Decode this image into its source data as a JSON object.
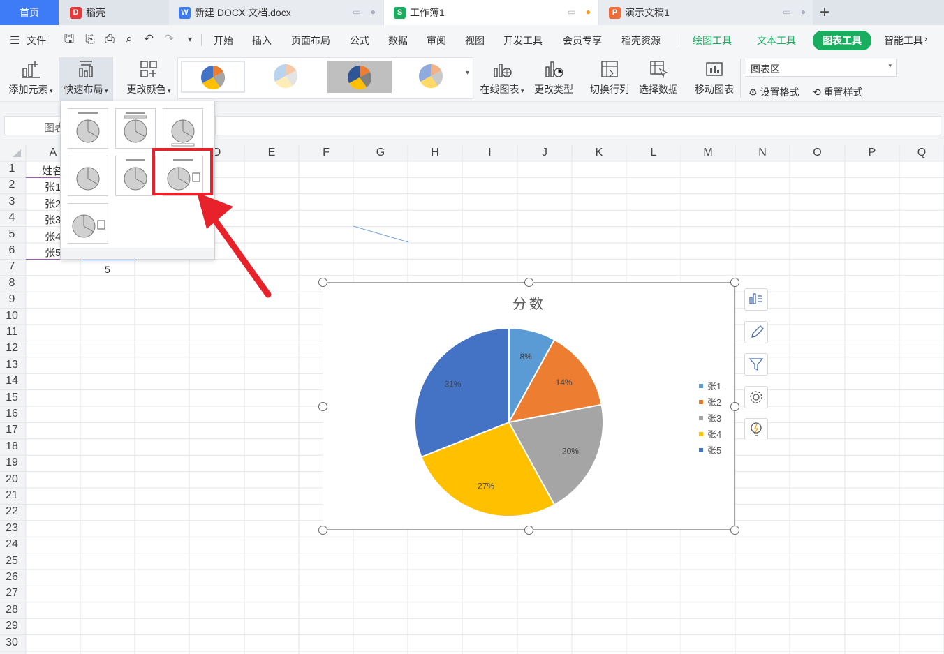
{
  "tabs": [
    {
      "label": "首页",
      "icon": "home-tab"
    },
    {
      "label": "稻壳",
      "icon": "docer-icon"
    },
    {
      "label": "新建 DOCX 文档.docx",
      "icon": "word-icon"
    },
    {
      "label": "工作簿1",
      "icon": "sheet-icon"
    },
    {
      "label": "演示文稿1",
      "icon": "ppt-icon"
    }
  ],
  "menu": {
    "file": "文件",
    "items": [
      "开始",
      "插入",
      "页面布局",
      "公式",
      "数据",
      "审阅",
      "视图",
      "开发工具",
      "会员专享",
      "稻壳资源"
    ],
    "context": [
      "绘图工具",
      "文本工具",
      "图表工具",
      "智能工具"
    ]
  },
  "ribbon": {
    "add_element": "添加元素",
    "quick_layout": "快速布局",
    "change_color": "更改颜色",
    "online_chart": "在线图表",
    "change_type": "更改类型",
    "switch_rowcol": "切换行列",
    "select_data": "选择数据",
    "move_chart": "移动图表",
    "chart_area": "图表区",
    "set_format": "设置格式",
    "reset_style": "重置样式"
  },
  "namebox": "图表",
  "columns": [
    "A",
    "B",
    "C",
    "D",
    "E",
    "F",
    "G",
    "H",
    "I",
    "J",
    "K",
    "L",
    "M",
    "N",
    "O",
    "P",
    "Q"
  ],
  "rows": [
    "1",
    "2",
    "3",
    "4",
    "5",
    "6",
    "7",
    "8",
    "9",
    "10",
    "11",
    "12",
    "13",
    "14",
    "15",
    "16",
    "17",
    "18",
    "19",
    "20",
    "21",
    "22",
    "23",
    "24",
    "25",
    "26",
    "27",
    "28",
    "29",
    "30"
  ],
  "cells": {
    "a1": "姓名",
    "a2": "张1",
    "a3": "张2",
    "a4": "张3",
    "a5": "张4",
    "a6": "张5",
    "b7": "5"
  },
  "colors": {
    "accent_green": "#1aad60",
    "highlight_red": "#e8222b",
    "chart_blue": "#5b9bd5",
    "chart_orange": "#ed7d31",
    "chart_gray": "#a5a5a5",
    "chart_yellow": "#ffc000",
    "chart_darkblue": "#4472c4"
  },
  "chart_data": {
    "type": "pie",
    "title": "分数",
    "categories": [
      "张1",
      "张2",
      "张3",
      "张4",
      "张5"
    ],
    "values": [
      8,
      14,
      20,
      27,
      31
    ],
    "labels": [
      "8%",
      "14%",
      "20%",
      "27%",
      "31%"
    ],
    "colors": [
      "#5b9bd5",
      "#ed7d31",
      "#a5a5a5",
      "#ffc000",
      "#4472c4"
    ],
    "legend": "right"
  },
  "side_tools": [
    "chart-elements-icon",
    "chart-style-icon",
    "chart-filter-icon",
    "chart-settings-icon",
    "smart-idea-icon"
  ]
}
